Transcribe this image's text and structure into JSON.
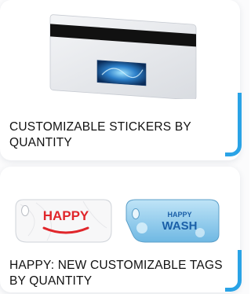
{
  "cards": [
    {
      "title": "CUSTOMIZABLE STICKERS BY QUANTITY"
    },
    {
      "title": "HAPPY: NEW CUSTOMIZABLE TAGS BY QUANTITY"
    }
  ],
  "tags": {
    "happy_label": "HAPPY",
    "wash_label_top": "HAPPY",
    "wash_label_bottom": "WASH"
  },
  "colors": {
    "accent": "#2aa3e6",
    "happy_red": "#e0262b",
    "wash_blue": "#1a5fa8"
  }
}
